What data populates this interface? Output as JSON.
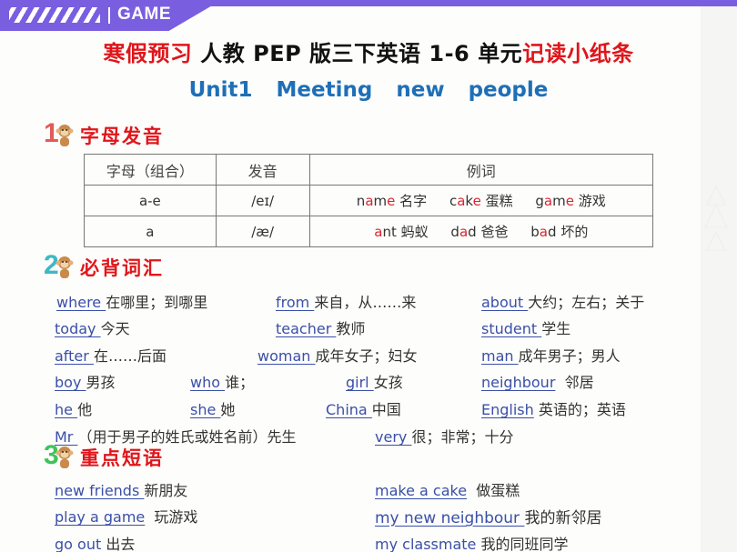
{
  "header": {
    "game_label": "GAME",
    "stripes_icon": "diagonal-stripes-icon"
  },
  "title": {
    "part1": "寒假预习",
    "part2": "人教 PEP 版三下英语 1-6 单元",
    "part3": "记读小纸条",
    "unit": "Unit1  Meeting  new  people"
  },
  "colors": {
    "brand_purple": "#7a5ee0",
    "title_red": "#e0151b",
    "unit_blue": "#1e6fb8",
    "link_blue": "#3a4fa8",
    "num1": "#e35a5a",
    "num2": "#3fb8c6",
    "num3": "#3ec45a"
  },
  "sections": {
    "s1": {
      "num": "1",
      "title": "字母发音",
      "icon": "monkey-icon"
    },
    "s2": {
      "num": "2",
      "title": "必背词汇",
      "icon": "monkey-icon"
    },
    "s3": {
      "num": "3",
      "title": "重点短语",
      "icon": "monkey-icon"
    }
  },
  "phonics_table": {
    "headers": [
      "字母（组合）",
      "发音",
      "例词"
    ],
    "rows": [
      {
        "letters": "a-e",
        "sound": "/eɪ/",
        "examples": [
          {
            "pre": "n",
            "hl": "a",
            "mid": "m",
            "hl2": "e",
            "post": "",
            "zh": "名字"
          },
          {
            "pre": "c",
            "hl": "a",
            "mid": "k",
            "hl2": "e",
            "post": "",
            "zh": "蛋糕"
          },
          {
            "pre": "g",
            "hl": "a",
            "mid": "m",
            "hl2": "e",
            "post": "",
            "zh": "游戏"
          }
        ]
      },
      {
        "letters": "a",
        "sound": "/æ/",
        "examples": [
          {
            "pre": "",
            "hl": "a",
            "mid": "nt",
            "hl2": "",
            "post": "",
            "zh": "蚂蚁"
          },
          {
            "pre": "d",
            "hl": "a",
            "mid": "d",
            "hl2": "",
            "post": "",
            "zh": "爸爸"
          },
          {
            "pre": "b",
            "hl": "a",
            "mid": "d",
            "hl2": "",
            "post": "",
            "zh": "坏的"
          }
        ]
      }
    ]
  },
  "vocabulary": [
    {
      "en": "where ",
      "zh": "在哪里；到哪里"
    },
    {
      "en": "from ",
      "zh": "来自，从……来"
    },
    {
      "en": "about ",
      "zh": "大约；左右；关于"
    },
    {
      "en": "today ",
      "zh": "今天"
    },
    {
      "en": "teacher ",
      "zh": "教师"
    },
    {
      "en": "student ",
      "zh": "学生"
    },
    {
      "en": "after ",
      "zh": "在……后面"
    },
    {
      "en": "woman ",
      "zh": "成年女子；妇女"
    },
    {
      "en": "man ",
      "zh": "成年男子；男人"
    },
    {
      "en": "boy ",
      "zh": "男孩"
    },
    {
      "en": "who ",
      "zh": "谁；"
    },
    {
      "en": "girl ",
      "zh": "女孩"
    },
    {
      "en": "neighbour",
      "zh": "  邻居"
    },
    {
      "en": "he ",
      "zh": "他"
    },
    {
      "en": "she ",
      "zh": "她"
    },
    {
      "en": "China ",
      "zh": "中国"
    },
    {
      "en": "English",
      "zh": " 英语的；英语"
    },
    {
      "en": "Mr ",
      "zh": "（用于男子的姓氏或姓名前）先生"
    },
    {
      "en": "very ",
      "zh": "很；非常；十分"
    }
  ],
  "phrases": [
    {
      "en": "new friends ",
      "zh": "新朋友"
    },
    {
      "en": "make a cake",
      "zh": "  做蛋糕"
    },
    {
      "en": "play a game",
      "zh": "  玩游戏"
    },
    {
      "en": "my new neighbour ",
      "zh": "我的新邻居"
    },
    {
      "en": "go out ",
      "zh": "出去"
    },
    {
      "en": "my classmate ",
      "zh": "我的同班同学"
    }
  ]
}
